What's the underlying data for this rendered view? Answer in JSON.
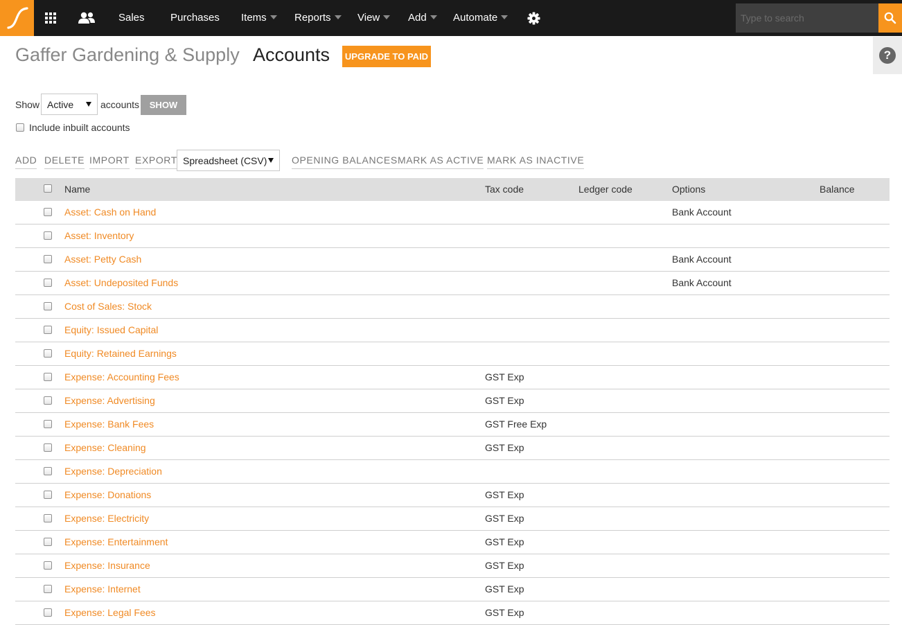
{
  "nav": {
    "items": [
      {
        "label": "Sales",
        "dropdown": false
      },
      {
        "label": "Purchases",
        "dropdown": false
      },
      {
        "label": "Items",
        "dropdown": true
      },
      {
        "label": "Reports",
        "dropdown": true
      },
      {
        "label": "View",
        "dropdown": true
      },
      {
        "label": "Add",
        "dropdown": true
      },
      {
        "label": "Automate",
        "dropdown": true
      }
    ],
    "search_placeholder": "Type to search",
    "icons": [
      "logo-icon",
      "apps-grid-icon",
      "contacts-icon",
      "gear-icon",
      "search-icon"
    ],
    "accent_color": "#f7941d"
  },
  "header": {
    "company": "Gaffer Gardening & Supply",
    "title": "Accounts",
    "upgrade_label": "UPGRADE TO PAID",
    "help_label": "?"
  },
  "filter": {
    "show_label": "Show",
    "status_value": "Active",
    "accounts_label": "accounts",
    "show_button": "SHOW",
    "include_inbuilt_label": "Include inbuilt accounts"
  },
  "toolbar": {
    "add": "ADD",
    "delete": "DELETE",
    "import": "IMPORT",
    "export": "EXPORT",
    "export_format": "Spreadsheet (CSV)",
    "opening_balances": "OPENING BALANCES",
    "mark_active": "MARK AS ACTIVE",
    "mark_inactive": "MARK AS INACTIVE"
  },
  "table": {
    "headers": {
      "name": "Name",
      "tax_code": "Tax code",
      "ledger_code": "Ledger code",
      "options": "Options",
      "balance": "Balance"
    },
    "rows": [
      {
        "name": "Asset: Cash on Hand",
        "tax_code": "",
        "ledger_code": "",
        "options": "Bank Account",
        "balance": ""
      },
      {
        "name": "Asset: Inventory",
        "tax_code": "",
        "ledger_code": "",
        "options": "",
        "balance": ""
      },
      {
        "name": "Asset: Petty Cash",
        "tax_code": "",
        "ledger_code": "",
        "options": "Bank Account",
        "balance": ""
      },
      {
        "name": "Asset: Undeposited Funds",
        "tax_code": "",
        "ledger_code": "",
        "options": "Bank Account",
        "balance": ""
      },
      {
        "name": "Cost of Sales: Stock",
        "tax_code": "",
        "ledger_code": "",
        "options": "",
        "balance": ""
      },
      {
        "name": "Equity: Issued Capital",
        "tax_code": "",
        "ledger_code": "",
        "options": "",
        "balance": ""
      },
      {
        "name": "Equity: Retained Earnings",
        "tax_code": "",
        "ledger_code": "",
        "options": "",
        "balance": ""
      },
      {
        "name": "Expense: Accounting Fees",
        "tax_code": "GST Exp",
        "ledger_code": "",
        "options": "",
        "balance": ""
      },
      {
        "name": "Expense: Advertising",
        "tax_code": "GST Exp",
        "ledger_code": "",
        "options": "",
        "balance": ""
      },
      {
        "name": "Expense: Bank Fees",
        "tax_code": "GST Free Exp",
        "ledger_code": "",
        "options": "",
        "balance": ""
      },
      {
        "name": "Expense: Cleaning",
        "tax_code": "GST Exp",
        "ledger_code": "",
        "options": "",
        "balance": ""
      },
      {
        "name": "Expense: Depreciation",
        "tax_code": "",
        "ledger_code": "",
        "options": "",
        "balance": ""
      },
      {
        "name": "Expense: Donations",
        "tax_code": "GST Exp",
        "ledger_code": "",
        "options": "",
        "balance": ""
      },
      {
        "name": "Expense: Electricity",
        "tax_code": "GST Exp",
        "ledger_code": "",
        "options": "",
        "balance": ""
      },
      {
        "name": "Expense: Entertainment",
        "tax_code": "GST Exp",
        "ledger_code": "",
        "options": "",
        "balance": ""
      },
      {
        "name": "Expense: Insurance",
        "tax_code": "GST Exp",
        "ledger_code": "",
        "options": "",
        "balance": ""
      },
      {
        "name": "Expense: Internet",
        "tax_code": "GST Exp",
        "ledger_code": "",
        "options": "",
        "balance": ""
      },
      {
        "name": "Expense: Legal Fees",
        "tax_code": "GST Exp",
        "ledger_code": "",
        "options": "",
        "balance": ""
      }
    ]
  }
}
